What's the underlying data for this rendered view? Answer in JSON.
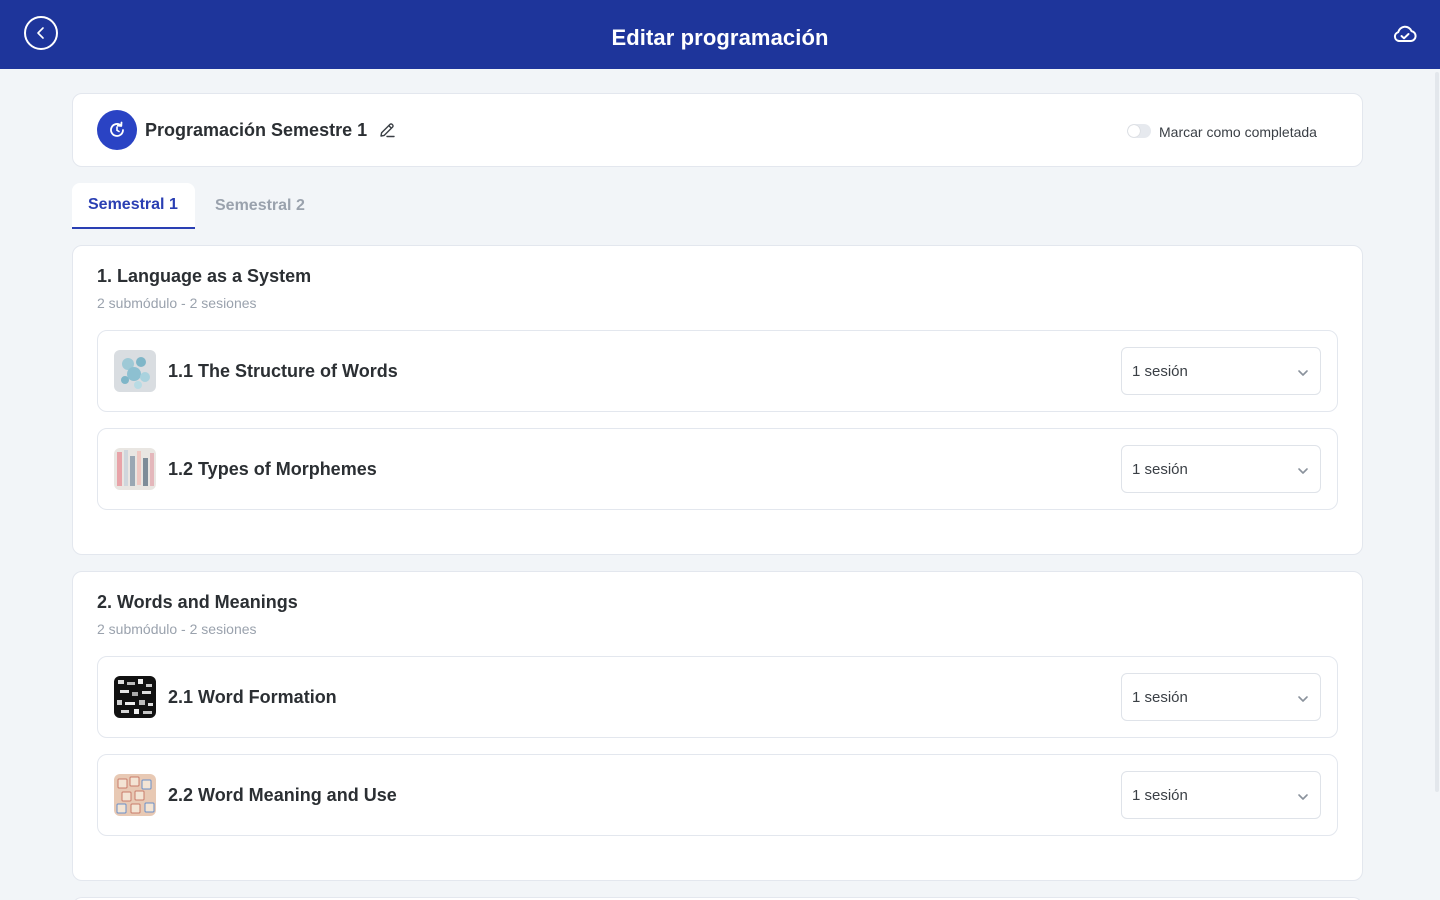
{
  "header": {
    "title": "Editar programación"
  },
  "program": {
    "name": "Programación Semestre 1",
    "toggle_label": "Marcar como completada",
    "completed": false
  },
  "tabs": [
    {
      "label": "Semestral 1",
      "active": true
    },
    {
      "label": "Semestral 2",
      "active": false
    }
  ],
  "modules": [
    {
      "title": "1. Language as a System",
      "meta": "2 submódulo - 2 sesiones",
      "submodules": [
        {
          "title": "1.1 The Structure of Words",
          "sessions": "1 sesión"
        },
        {
          "title": "1.2 Types of Morphemes",
          "sessions": "1 sesión"
        }
      ]
    },
    {
      "title": "2. Words and Meanings",
      "meta": "2 submódulo - 2 sesiones",
      "submodules": [
        {
          "title": "2.1 Word Formation",
          "sessions": "1 sesión"
        },
        {
          "title": "2.2 Word Meaning and Use",
          "sessions": "1 sesión"
        }
      ]
    }
  ],
  "colors": {
    "header_bg": "#1e359b",
    "accent": "#2a3fb3",
    "page_bg": "#f2f5f8"
  },
  "icons": {
    "back": "arrow-left-circle-icon",
    "save": "cloud-check-icon",
    "program": "refresh-clock-icon",
    "edit": "pencil-icon",
    "dropdown": "chevron-down-icon"
  }
}
